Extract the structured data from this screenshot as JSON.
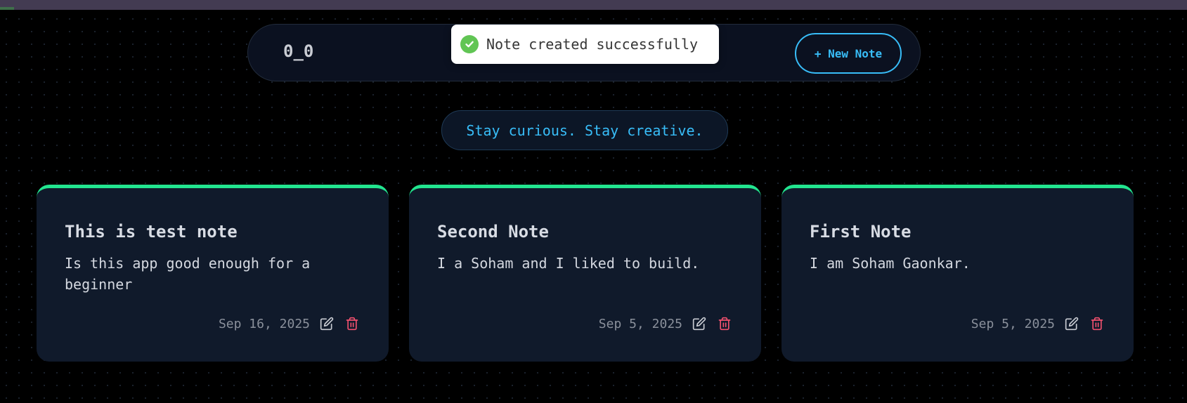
{
  "app": {
    "logo": "0_0",
    "new_note_label": "+ New Note",
    "tagline": "Stay curious. Stay creative."
  },
  "toast": {
    "message": "Note created successfully",
    "icon": "check-circle-icon",
    "color": "#61c554"
  },
  "notes": [
    {
      "title": "This is test note",
      "body": "Is this app good enough for a beginner",
      "date": "Sep 16, 2025"
    },
    {
      "title": "Second Note",
      "body": "I a Soham and I liked to build.",
      "date": "Sep 5, 2025"
    },
    {
      "title": "First Note",
      "body": "I am Soham Gaonkar.",
      "date": "Sep 5, 2025"
    }
  ],
  "colors": {
    "accent": "#38bdf8",
    "card_top_border": "#22e58f",
    "delete": "#f0506e",
    "card_bg": "#101a2b"
  },
  "icons": {
    "edit": "edit-icon",
    "delete": "trash-icon"
  }
}
